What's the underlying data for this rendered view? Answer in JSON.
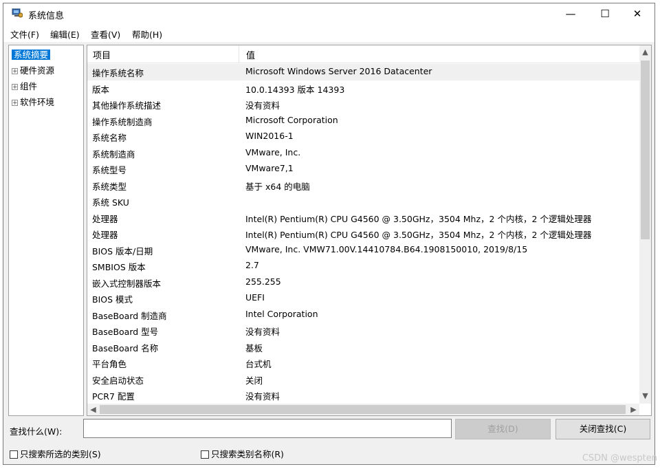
{
  "window": {
    "title": "系统信息",
    "minimize_glyph": "—",
    "maximize_glyph": "☐",
    "close_glyph": "✕"
  },
  "menu": [
    "文件(F)",
    "编辑(E)",
    "查看(V)",
    "帮助(H)"
  ],
  "tree": {
    "selected": "系统摘要",
    "items": [
      "硬件资源",
      "组件",
      "软件环境"
    ]
  },
  "table": {
    "columns": [
      "项目",
      "值"
    ],
    "rows": [
      {
        "item": "操作系统名称",
        "value": "Microsoft Windows Server 2016 Datacenter"
      },
      {
        "item": "版本",
        "value": "10.0.14393 版本 14393"
      },
      {
        "item": "其他操作系统描述",
        "value": "没有资料"
      },
      {
        "item": "操作系统制造商",
        "value": "Microsoft Corporation"
      },
      {
        "item": "系统名称",
        "value": "WIN2016-1"
      },
      {
        "item": "系统制造商",
        "value": "VMware, Inc."
      },
      {
        "item": "系统型号",
        "value": "VMware7,1"
      },
      {
        "item": "系统类型",
        "value": "基于 x64 的电脑"
      },
      {
        "item": "系统 SKU",
        "value": ""
      },
      {
        "item": "处理器",
        "value": "Intel(R) Pentium(R) CPU G4560 @ 3.50GHz，3504 Mhz，2 个内核，2 个逻辑处理器"
      },
      {
        "item": "处理器",
        "value": "Intel(R) Pentium(R) CPU G4560 @ 3.50GHz，3504 Mhz，2 个内核，2 个逻辑处理器"
      },
      {
        "item": "BIOS 版本/日期",
        "value": "VMware, Inc. VMW71.00V.14410784.B64.1908150010, 2019/8/15"
      },
      {
        "item": "SMBIOS 版本",
        "value": "2.7"
      },
      {
        "item": "嵌入式控制器版本",
        "value": "255.255"
      },
      {
        "item": "BIOS 模式",
        "value": "UEFI"
      },
      {
        "item": "BaseBoard 制造商",
        "value": "Intel Corporation"
      },
      {
        "item": "BaseBoard 型号",
        "value": "没有资料"
      },
      {
        "item": "BaseBoard 名称",
        "value": "基板"
      },
      {
        "item": "平台角色",
        "value": "台式机"
      },
      {
        "item": "安全启动状态",
        "value": "关闭"
      },
      {
        "item": "PCR7 配置",
        "value": "没有资料"
      }
    ]
  },
  "search": {
    "label": "查找什么(W):",
    "value": "",
    "find_button": "查找(D)",
    "close_find_button": "关闭查找(C)",
    "only_selected_label": "只搜索所选的类别(S)",
    "only_names_label": "只搜索类别名称(R)"
  },
  "watermark": "CSDN @wespten",
  "icons": {
    "app": "system-info-icon",
    "scroll_up": "▲",
    "scroll_down": "▼",
    "scroll_left": "◀",
    "scroll_right": "▶",
    "expander": "+"
  },
  "colors": {
    "selection": "#0078d7",
    "first_row_highlight": "#f0f0f0"
  }
}
